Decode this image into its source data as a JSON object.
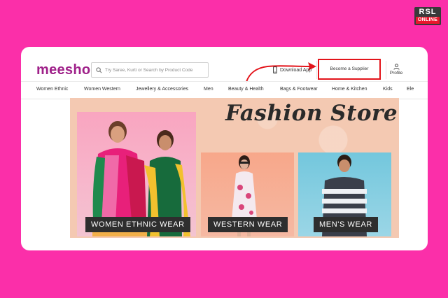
{
  "watermark": {
    "line1": "RSL",
    "line2": "ONLINE"
  },
  "header": {
    "logo": "meesho",
    "search_placeholder": "Try Saree, Kurti or Search by Product Code",
    "download_app": "Download App",
    "become_supplier": "Become a Supplier",
    "profile": "Profile"
  },
  "categories": [
    "Women Ethnic",
    "Women Western",
    "Jewellery & Accessories",
    "Men",
    "Beauty & Health",
    "Bags & Footwear",
    "Home & Kitchen",
    "Kids",
    "Ele"
  ],
  "banner": {
    "title": "Fashion Store",
    "panels": [
      {
        "label": "WOMEN ETHNIC WEAR"
      },
      {
        "label": "WESTERN WEAR"
      },
      {
        "label": "MEN'S WEAR"
      }
    ]
  },
  "colors": {
    "background": "#FB2FA9",
    "brand": "#9F2089",
    "highlight": "#E3141B"
  }
}
